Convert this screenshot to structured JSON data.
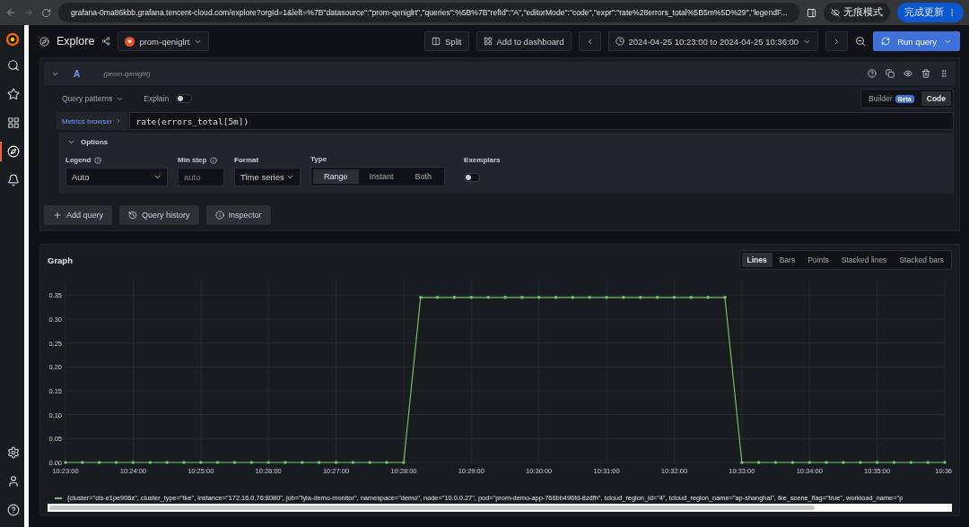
{
  "browser": {
    "url": "grafana-0ma86kbb.grafana.tencent-cloud.com/explore?orgId=1&left=%7B\"datasource\":\"prom-qeniglrt\",\"queries\":%5B%7B\"refId\":\"A\",\"editorMode\":\"code\",\"expr\":\"rate%28errors_total%5B5m%5D%29\",\"legendF...",
    "incognito": "无痕模式",
    "update": "完成更新"
  },
  "sidebar": {
    "items": [
      {
        "kind": "search",
        "selected": false
      },
      {
        "kind": "star",
        "selected": false
      },
      {
        "kind": "grid",
        "selected": false
      },
      {
        "kind": "compass",
        "selected": true
      },
      {
        "kind": "bell",
        "selected": false
      }
    ],
    "bottom": [
      {
        "kind": "gear"
      },
      {
        "kind": "avatar"
      },
      {
        "kind": "help"
      }
    ]
  },
  "header": {
    "title": "Explore",
    "datasource": "prom-qeniglrt",
    "split": "Split",
    "add_to_dashboard": "Add to dashboard",
    "time_range": "2024-04-25 10:23:00 to 2024-04-25 10:36:00",
    "run": "Run query"
  },
  "query": {
    "ref": "A",
    "datasource": "(prom-qeniglrt)",
    "patterns": "Query patterns",
    "explain": {
      "label": "Explain",
      "on": false
    },
    "modes": [
      {
        "label": "Builder",
        "badge": "Beta",
        "selected": false
      },
      {
        "label": "Code",
        "selected": true
      }
    ],
    "metrics_browser": "Metrics browser",
    "expr": "rate(errors_total[5m])",
    "options": {
      "title": "Options",
      "expanded": true,
      "legend": {
        "label": "Legend",
        "value": "Auto"
      },
      "min_step": {
        "label": "Min step",
        "placeholder": "auto"
      },
      "format": {
        "label": "Format",
        "value": "Time series"
      },
      "type": {
        "label": "Type",
        "options": [
          {
            "label": "Range",
            "selected": true
          },
          {
            "label": "Instant",
            "selected": false
          },
          {
            "label": "Both",
            "selected": false
          }
        ]
      },
      "exemplars": {
        "label": "Exemplars",
        "on": false
      }
    }
  },
  "actions": [
    {
      "kind": "add",
      "label": "Add query"
    },
    {
      "kind": "history",
      "label": "Query history"
    },
    {
      "kind": "info",
      "label": "Inspector"
    }
  ],
  "graph": {
    "title": "Graph",
    "styles": [
      {
        "label": "Lines",
        "selected": true
      },
      {
        "label": "Bars",
        "selected": false
      },
      {
        "label": "Points",
        "selected": false
      },
      {
        "label": "Stacked lines",
        "selected": false
      },
      {
        "label": "Stacked bars",
        "selected": false
      }
    ],
    "chart_data": {
      "type": "line",
      "categories": [
        "10:23:00",
        null,
        null,
        null,
        "10:24:00",
        null,
        null,
        null,
        "10:25:00",
        null,
        null,
        null,
        "10:26:00",
        null,
        null,
        null,
        "10:27:00",
        null,
        null,
        null,
        "10:28:00",
        null,
        null,
        null,
        "10:29:00",
        null,
        null,
        null,
        "10:30:00",
        null,
        null,
        null,
        "10:31:00",
        null,
        null,
        null,
        "10:32:00",
        null,
        null,
        null,
        "10:33:00",
        null,
        null,
        null,
        "10:34:00",
        null,
        null,
        null,
        "10:35:00",
        null,
        null,
        null,
        "10:36"
      ],
      "grid": true,
      "series": [
        {
          "name": "{cluster=\"cls-e1pe906z\", cluster_type=\"tke\", instance=\"172.16.0.76:8080\", job=\"lyla-demo-monitor\", namespace=\"demo\", node=\"10.0.0.27\", pod=\"prom-demo-app-766bb496fd-8zdfh\", tcloud_region_id=\"4\", tcloud_region_name=\"ap-shanghai\", tke_scene_flag=\"true\", workload_name=\"p",
          "color": "#73bf69",
          "values": [
            0,
            0,
            0,
            0,
            0,
            0,
            0,
            0,
            0,
            0,
            0,
            0,
            0,
            0,
            0,
            0,
            0,
            0,
            0,
            0,
            0,
            0.345,
            0.345,
            0.345,
            0.345,
            0.345,
            0.345,
            0.345,
            0.345,
            0.345,
            0.345,
            0.345,
            0.345,
            0.345,
            0.345,
            0.345,
            0.345,
            0.345,
            0.345,
            0.345,
            0,
            0,
            0,
            0,
            0,
            0,
            0,
            0,
            0,
            0,
            0,
            0,
            0
          ]
        }
      ],
      "ylim": [
        0,
        0.35
      ],
      "yticks": [
        {
          "value": 0,
          "label": "0.00"
        },
        {
          "value": 0.05,
          "label": "0.05"
        },
        {
          "value": 0.1,
          "label": "0.10"
        },
        {
          "value": 0.15,
          "label": "0.15"
        },
        {
          "value": 0.2,
          "label": "0.20"
        },
        {
          "value": 0.25,
          "label": "0.25"
        },
        {
          "value": 0.3,
          "label": "0.30"
        },
        {
          "value": 0.35,
          "label": "0.35"
        }
      ]
    }
  }
}
